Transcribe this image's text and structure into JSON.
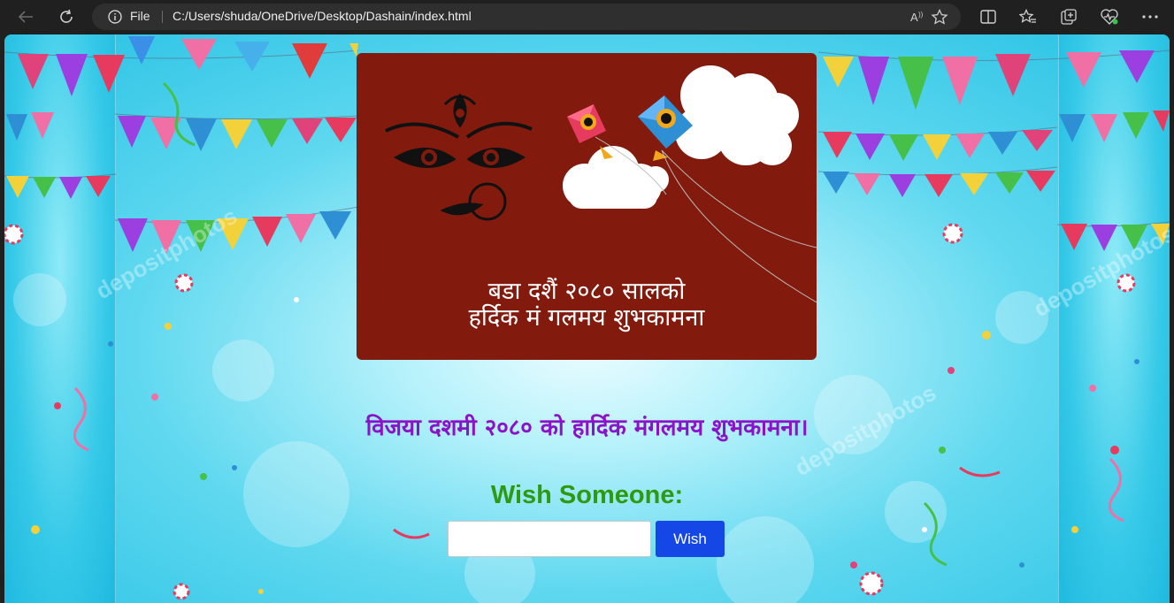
{
  "browser": {
    "back_icon": "back-arrow-icon",
    "reload_icon": "reload-icon",
    "site_info_icon": "info-icon",
    "scheme_label": "File",
    "url": "C:/Users/shuda/OneDrive/Desktop/Dashain/index.html",
    "toolbar_icons": [
      "read-aloud-icon",
      "favorite-star-icon",
      "split-screen-icon",
      "favorites-icon",
      "collections-icon",
      "browser-essentials-icon",
      "more-menu-icon"
    ]
  },
  "card": {
    "line1": "बडा दशैं २०८० सालको",
    "line2": "हर्दिक मं गलमय शुभकामना",
    "background_color": "#821b0d"
  },
  "main": {
    "greeting": "विजया दशमी २०८० को हार्दिक मंगलमय शुभकामना।",
    "greeting_color": "#8a12c9",
    "form_heading": "Wish Someone:",
    "form_heading_color": "#2e9a10",
    "name_input_value": "",
    "name_input_placeholder": "",
    "wish_button_label": "Wish",
    "wish_button_color": "#1447e6"
  },
  "watermark": "depositphotos"
}
